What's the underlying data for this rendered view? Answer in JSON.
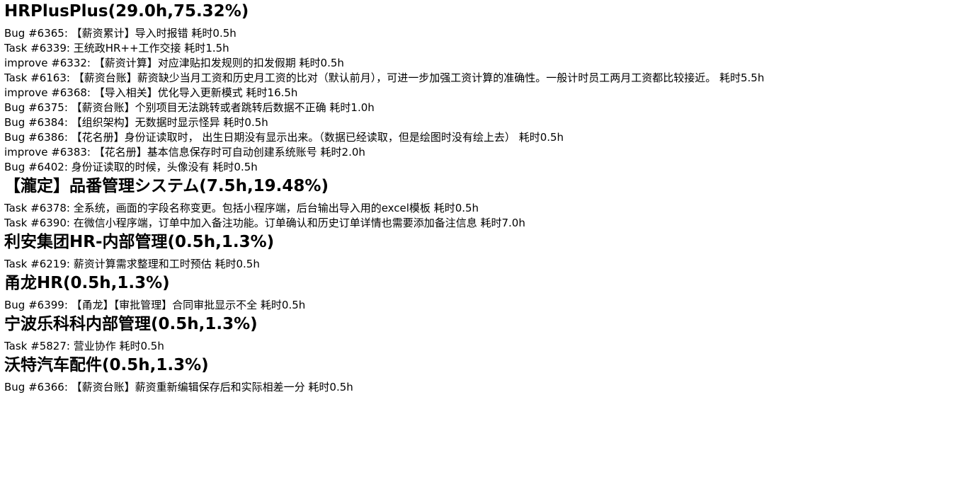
{
  "projects": [
    {
      "title": "HRPlusPlus(29.0h,75.32%)",
      "items": [
        "Bug #6365: 【薪资累计】导入时报错 耗时0.5h",
        "Task #6339: 王统政HR++工作交接 耗时1.5h",
        "improve #6332: 【薪资计算】对应津贴扣发规则的扣发假期 耗时0.5h",
        "Task #6163: 【薪资台账】薪资缺少当月工资和历史月工资的比对（默认前月），可进一步加强工资计算的准确性。一般计时员工两月工资都比较接近。 耗时5.5h",
        "improve #6368: 【导入相关】优化导入更新模式 耗时16.5h",
        "Bug #6375: 【薪资台账】个别项目无法跳转或者跳转后数据不正确 耗时1.0h",
        "Bug #6384: 【组织架构】无数据时显示怪异 耗时0.5h",
        "Bug #6386: 【花名册】身份证读取时， 出生日期没有显示出来。（数据已经读取，但是绘图时没有绘上去） 耗时0.5h",
        "improve #6383: 【花名册】基本信息保存时可自动创建系统账号 耗时2.0h",
        "Bug #6402: 身份证读取的时候，头像没有 耗时0.5h"
      ]
    },
    {
      "title": "【瀧定】品番管理システム(7.5h,19.48%)",
      "items": [
        "Task #6378: 全系统，画面的字段名称变更。包括小程序端，后台输出导入用的excel模板 耗时0.5h",
        "Task #6390: 在微信小程序端，订单中加入备注功能。订单确认和历史订单详情也需要添加备注信息 耗时7.0h"
      ]
    },
    {
      "title": "利安集团HR-内部管理(0.5h,1.3%)",
      "items": [
        "Task #6219: 薪资计算需求整理和工时预估 耗时0.5h"
      ]
    },
    {
      "title": "甬龙HR(0.5h,1.3%)",
      "items": [
        "Bug #6399: 【甬龙】【审批管理】合同审批显示不全 耗时0.5h"
      ]
    },
    {
      "title": "宁波乐科科内部管理(0.5h,1.3%)",
      "items": [
        "Task #5827: 营业协作 耗时0.5h"
      ]
    },
    {
      "title": "沃特汽车配件(0.5h,1.3%)",
      "items": [
        "Bug #6366: 【薪资台账】薪资重新编辑保存后和实际相差一分 耗时0.5h"
      ]
    }
  ]
}
